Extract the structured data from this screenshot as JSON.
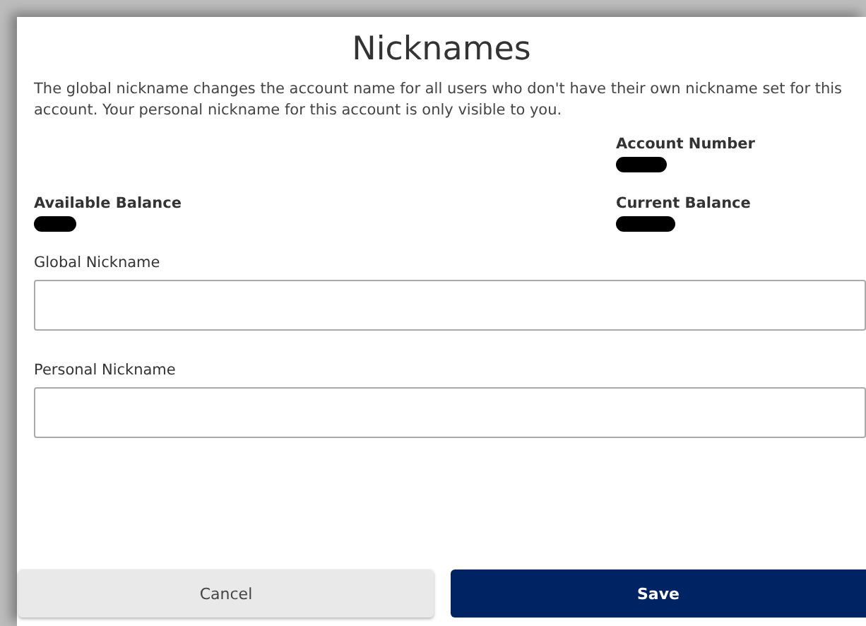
{
  "dialog": {
    "title": "Nicknames",
    "description": "The global nickname changes the account name for all users who don't have their own nickname set for this account. Your personal nickname for this account is only visible to you.",
    "details": {
      "left": [
        {
          "label": "Available Balance",
          "redacted": true
        }
      ],
      "right": [
        {
          "label": "Account Number",
          "redacted": true
        },
        {
          "label": "Current Balance",
          "redacted": true
        }
      ]
    },
    "fields": [
      {
        "label": "Global Nickname"
      },
      {
        "label": "Personal Nickname"
      }
    ],
    "buttons": [
      {
        "label": "Cancel",
        "kind": "secondary"
      },
      {
        "label": "Save",
        "kind": "primary"
      }
    ]
  }
}
